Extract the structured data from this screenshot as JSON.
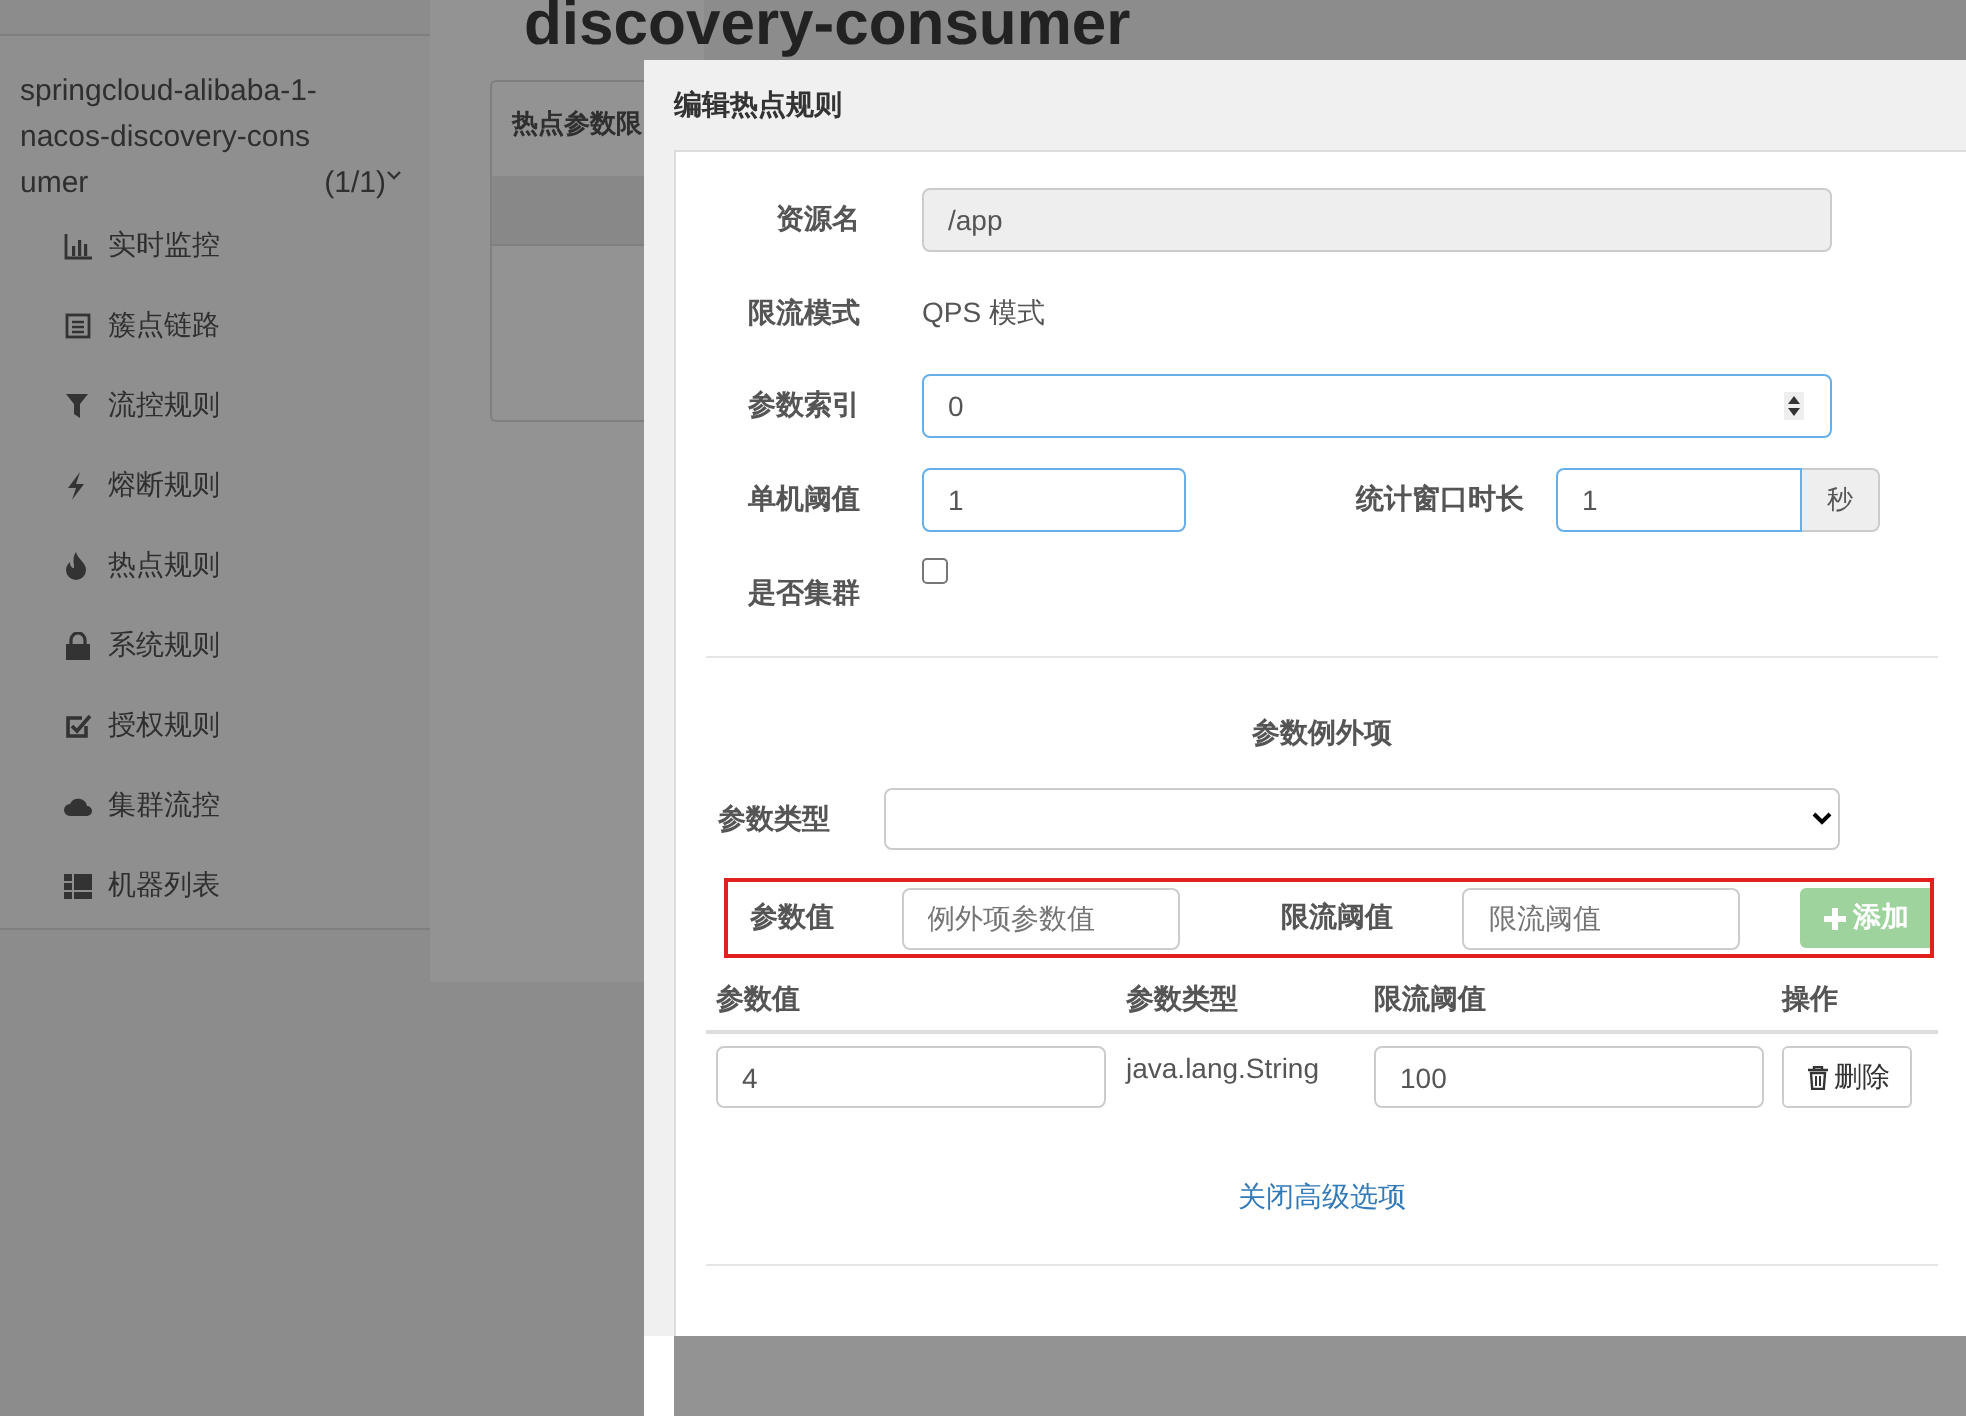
{
  "sidebar": {
    "app": {
      "name": "springcloud-alibaba-1-nacos-discovery-consumer",
      "count": "(1/1)",
      "expanded": true
    },
    "items": [
      {
        "label": "实时监控"
      },
      {
        "label": "簇点链路"
      },
      {
        "label": "流控规则"
      },
      {
        "label": "熔断规则"
      },
      {
        "label": "热点规则"
      },
      {
        "label": "系统规则"
      },
      {
        "label": "授权规则"
      },
      {
        "label": "集群流控"
      },
      {
        "label": "机器列表"
      }
    ]
  },
  "main": {
    "heading": "discovery-consumer",
    "panel_title": "热点参数限"
  },
  "dialog": {
    "title": "编辑热点规则",
    "resource": {
      "label": "资源名",
      "value": "/app",
      "disabled": true
    },
    "mode": {
      "label": "限流模式",
      "value": "QPS 模式"
    },
    "param_index": {
      "label": "参数索引",
      "value": "0"
    },
    "threshold": {
      "label": "单机阈值",
      "value": "1"
    },
    "window": {
      "label": "统计窗口时长",
      "value": "1",
      "unit": "秒"
    },
    "cluster": {
      "label": "是否集群",
      "checked": false
    },
    "exceptions": {
      "title": "参数例外项",
      "type_label": "参数类型",
      "new_item": {
        "value_label": "参数值",
        "value_placeholder": "例外项参数值",
        "threshold_label": "限流阈值",
        "threshold_placeholder": "限流阈值",
        "add_button": "添加",
        "add_disabled": true
      },
      "table": {
        "columns": [
          "参数值",
          "参数类型",
          "限流阈值",
          "操作"
        ],
        "rows": [
          {
            "value": "4",
            "type": "java.lang.String",
            "threshold": "100",
            "action": "删除"
          }
        ]
      }
    },
    "toggle_link": "关闭高级选项"
  }
}
